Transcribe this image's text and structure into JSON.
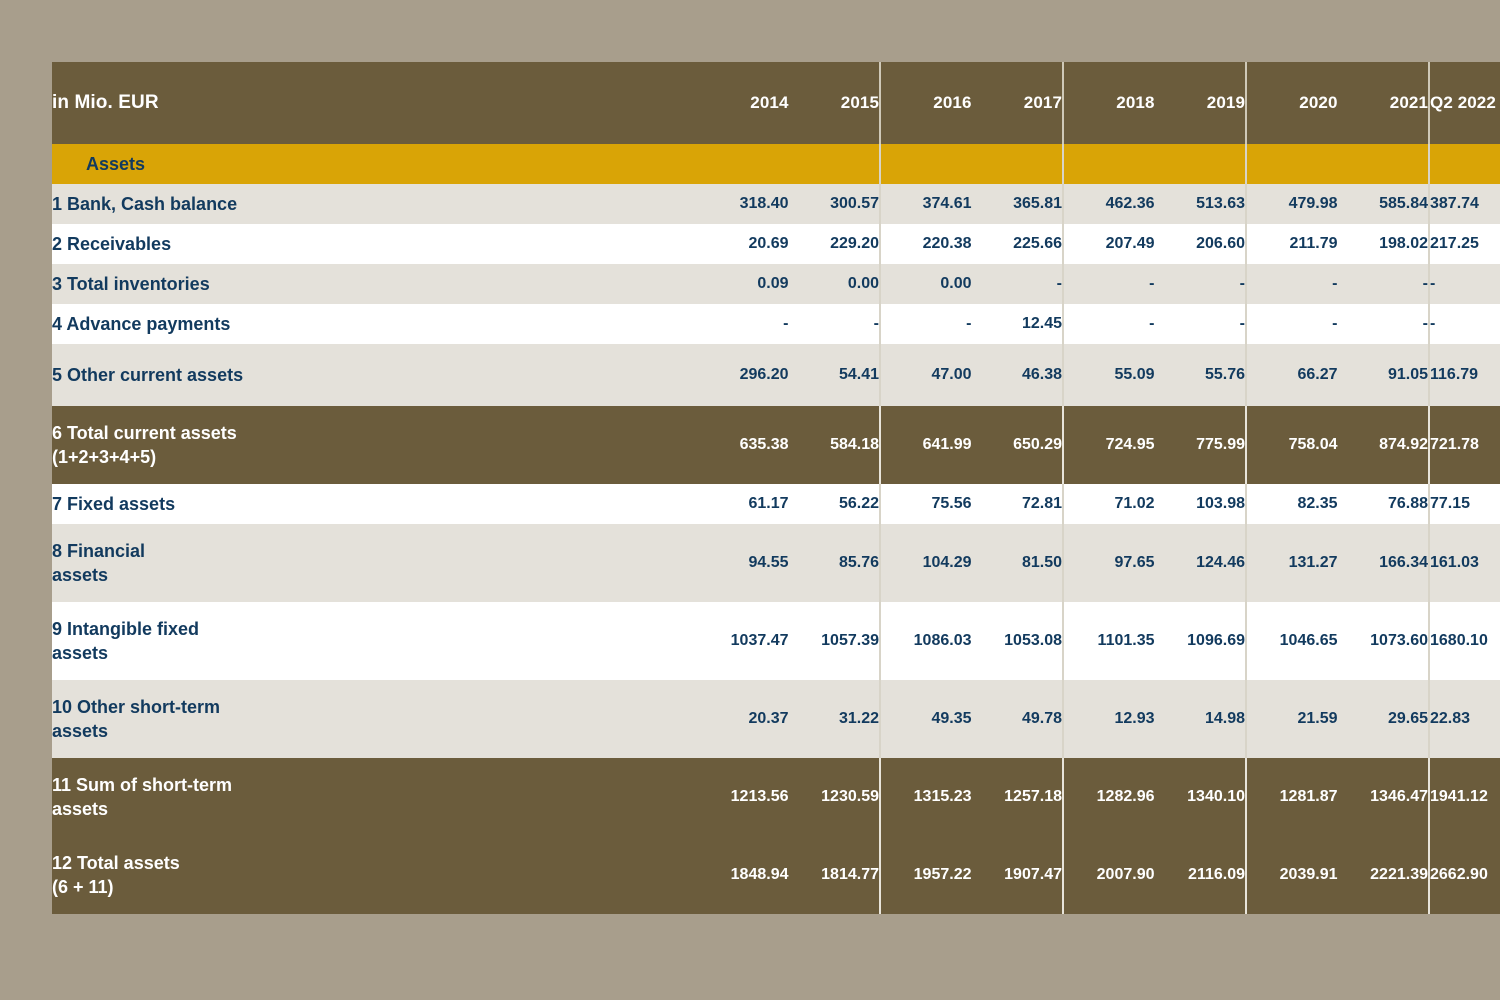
{
  "theme": {
    "page_background": "#a89e8c",
    "header_brown": "#6b5c3c",
    "accent_gold": "#d9a406",
    "text_navy": "#123a5e",
    "row_grey": "#e4e1da",
    "row_white": "#ffffff"
  },
  "table": {
    "unit_label": "in Mio. EUR",
    "columns": [
      "2014",
      "2015",
      "2016",
      "2017",
      "2018",
      "2019",
      "2020",
      "2021",
      "Q2 2022"
    ],
    "section_title": "Assets",
    "rows": [
      {
        "label": "1 Bank, Cash balance",
        "label_line2": "",
        "values": [
          "318.40",
          "300.57",
          "374.61",
          "365.81",
          "462.36",
          "513.63",
          "479.98",
          "585.84",
          "387.74"
        ]
      },
      {
        "label": "2 Receivables",
        "label_line2": "",
        "values": [
          "20.69",
          "229.20",
          "220.38",
          "225.66",
          "207.49",
          "206.60",
          "211.79",
          "198.02",
          "217.25"
        ]
      },
      {
        "label": "3 Total inventories",
        "label_line2": "",
        "values": [
          "0.09",
          "0.00",
          "0.00",
          "-",
          "-",
          "-",
          "-",
          "-",
          "-"
        ]
      },
      {
        "label": "4 Advance payments",
        "label_line2": "",
        "values": [
          "-",
          "-",
          "-",
          "12.45",
          "-",
          "-",
          "-",
          "-",
          "-"
        ]
      },
      {
        "label": "5 Other current assets",
        "label_line2": "",
        "values": [
          "296.20",
          "54.41",
          "47.00",
          "46.38",
          "55.09",
          "55.76",
          "66.27",
          "91.05",
          "116.79"
        ]
      },
      {
        "label": "6 Total current assets",
        "label_line2": "(1+2+3+4+5)",
        "values": [
          "635.38",
          "584.18",
          "641.99",
          "650.29",
          "724.95",
          "775.99",
          "758.04",
          "874.92",
          "721.78"
        ]
      },
      {
        "label": "7 Fixed assets",
        "label_line2": "",
        "values": [
          "61.17",
          "56.22",
          "75.56",
          "72.81",
          "71.02",
          "103.98",
          "82.35",
          "76.88",
          "77.15"
        ]
      },
      {
        "label": "8 Financial",
        "label_line2": "assets",
        "values": [
          "94.55",
          "85.76",
          "104.29",
          "81.50",
          "97.65",
          "124.46",
          "131.27",
          "166.34",
          "161.03"
        ]
      },
      {
        "label": "9 Intangible fixed",
        "label_line2": "assets",
        "values": [
          "1037.47",
          "1057.39",
          "1086.03",
          "1053.08",
          "1101.35",
          "1096.69",
          "1046.65",
          "1073.60",
          "1680.10"
        ]
      },
      {
        "label": "10 Other short-term",
        "label_line2": "assets",
        "values": [
          "20.37",
          "31.22",
          "49.35",
          "49.78",
          "12.93",
          "14.98",
          "21.59",
          "29.65",
          "22.83"
        ]
      },
      {
        "label": "11 Sum of short-term",
        "label_line2": "assets",
        "values": [
          "1213.56",
          "1230.59",
          "1315.23",
          "1257.18",
          "1282.96",
          "1340.10",
          "1281.87",
          "1346.47",
          "1941.12"
        ]
      },
      {
        "label": "12 Total assets",
        "label_line2": "(6 + 11)",
        "values": [
          "1848.94",
          "1814.77",
          "1957.22",
          "1907.47",
          "2007.90",
          "2116.09",
          "2039.91",
          "2221.39",
          "2662.90"
        ]
      }
    ]
  }
}
